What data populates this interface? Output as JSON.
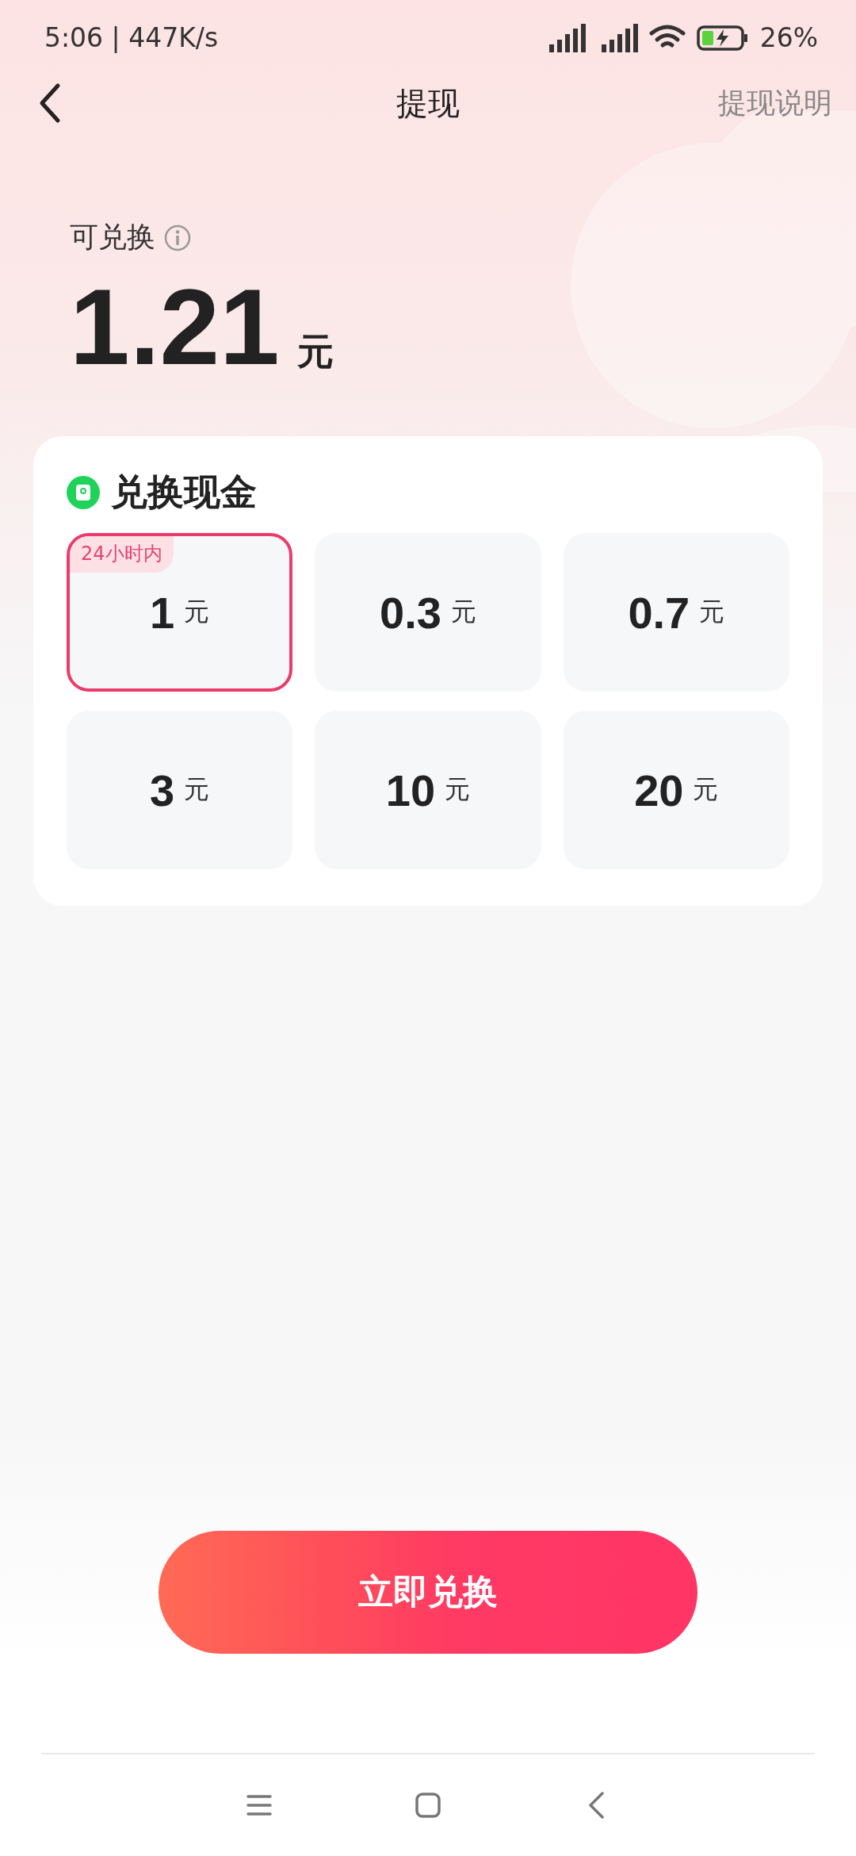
{
  "status_bar": {
    "time_speed": "5:06 | 447K/s",
    "battery": "26%"
  },
  "header": {
    "title": "提现",
    "link": "提现说明"
  },
  "balance": {
    "label": "可兑换",
    "amount": "1.21",
    "unit": "元"
  },
  "exchange": {
    "title": "兑换现金",
    "options": [
      {
        "amount": "1",
        "unit": "元",
        "selected": true,
        "badge": "24小时内"
      },
      {
        "amount": "0.3",
        "unit": "元",
        "selected": false
      },
      {
        "amount": "0.7",
        "unit": "元",
        "selected": false
      },
      {
        "amount": "3",
        "unit": "元",
        "selected": false
      },
      {
        "amount": "10",
        "unit": "元",
        "selected": false
      },
      {
        "amount": "20",
        "unit": "元",
        "selected": false
      }
    ]
  },
  "button": {
    "label": "立即兑换"
  }
}
